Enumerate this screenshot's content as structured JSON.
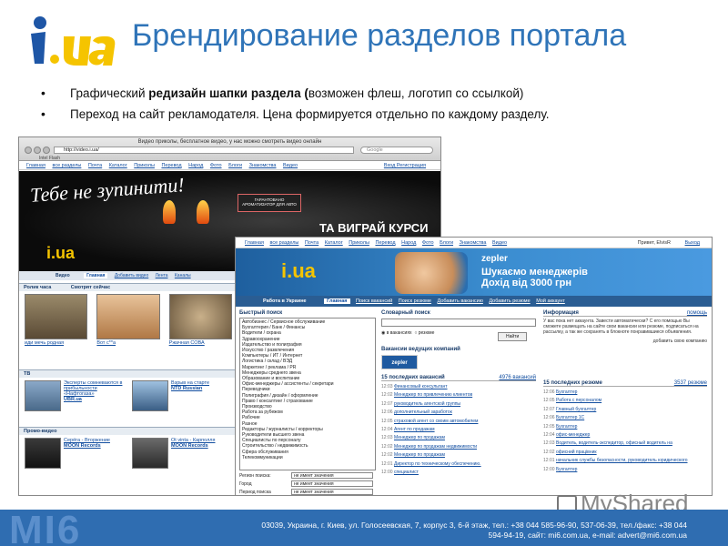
{
  "slide": {
    "title": "Брендирование разделов портала",
    "logo_text": "i.ua",
    "bullets": [
      {
        "pre": "Графический ",
        "bold": "редизайн шапки раздела (",
        "post": "возможен флеш, логотип со ссылкой)"
      },
      {
        "pre": "Переход на сайт рекламодателя. Цена формируется отдельно по каждому разделу.",
        "bold": "",
        "post": ""
      }
    ]
  },
  "screenshot1": {
    "window_title": "Видео приколы, бесплатное видео, у нас можно смотреть видео онлайн",
    "url": "http://video.i.ua/",
    "search_placeholder": "Google",
    "toolbar": "Intel  Flash",
    "site_nav": [
      "Главная",
      "все разделы",
      "Почта",
      "Каталог",
      "Приколы",
      "Перевод",
      "Народ",
      "Фото",
      "Блоги",
      "Знакомства",
      "Видео"
    ],
    "site_nav_right": "Вход   Регистрация",
    "banner": {
      "slogan": "Тебе не зупинити!",
      "badge": "Гарантовано ароматизатор для авто",
      "promo": "ТА ВИГРАЙ КУРСИ"
    },
    "tabs": {
      "section": "Видео",
      "items": [
        "Главная",
        "Добавить видео",
        "Лента",
        "Каналы"
      ]
    },
    "roll_header": "Ролик часа",
    "watch_header": "Смотрят сейчас",
    "thumbs": [
      "иди мечь родная",
      "Вот с**а",
      "Ржачная СОВА"
    ],
    "tv_header": "ТВ",
    "tv_items": [
      {
        "title": "Эксперты сомневаются в прибыльности «Нафтогаза»",
        "src": "UBR.ua"
      },
      {
        "title": "Взрыв на старте",
        "src": "NTD Russian"
      }
    ],
    "promo_header": "Промо-видео",
    "promo_items": [
      {
        "title": "Серёга - Вторжение",
        "src": "MOON Records"
      },
      {
        "title": "Ot vinta - Карполля",
        "src": "MOON Records"
      }
    ]
  },
  "screenshot2": {
    "nav": [
      "Главная",
      "все разделы",
      "Почта",
      "Каталог",
      "Приколы",
      "Перевод",
      "Народ",
      "Фото",
      "Блоги",
      "Знакомства",
      "Видео"
    ],
    "user": "Привет, ElvisR",
    "exit": "Выход",
    "banner": {
      "brand": "zepler",
      "line1": "Шукаємо менеджерів",
      "line2": "Дохід від 3000 грн"
    },
    "tabs": {
      "section": "Работа в Украине",
      "items": [
        "Главная",
        "Поиск вакансий",
        "Поиск резюме",
        "Добавить вакансию",
        "Добавить резюме",
        "Мой аккаунт"
      ]
    },
    "quick_search": "Быстрый поиск",
    "categories": [
      "Автобизнес / Сервисное обслуживание",
      "Бухгалтерия / Банк / Финансы",
      "Водители / охрана",
      "Здравоохранение",
      "Издательство и полиграфия",
      "Искусство / развлечения",
      "Компьютеры / ИТ / Интернет",
      "Логистика / склад / ВЭД",
      "Маркетинг / реклама / PR",
      "Менеджеры среднего звена",
      "Образование и воспитание",
      "Офис-менеджеры / ассистенты / секретари",
      "Переводчики",
      "Полиграфия / дизайн / оформление",
      "Право / консалтинг / страхование",
      "Производство",
      "Работа за рубежом",
      "Рабочие",
      "Разное",
      "Редакторы / журналисты / корректоры",
      "Руководители высшего звена",
      "Специалисты по персоналу",
      "Строительство / недвижимость",
      "Сфера обслуживания",
      "Телекоммуникации"
    ],
    "fields": [
      {
        "label": "Регион поиска:",
        "value": "не имеет значения"
      },
      {
        "label": "Город",
        "value": "не имеет значения"
      },
      {
        "label": "Период поиска",
        "value": "не имеет значения"
      }
    ],
    "dict_search": "Словарный поиск",
    "radio1": "в вакансиях",
    "radio2": "резюме",
    "find": "Найти",
    "leading": "Вакансии ведущих компаний",
    "zepler": "zepler",
    "vac_header": "15 последних вакансий",
    "vac_count": "4976 вакансий",
    "vacancies": [
      {
        "t": "12:03",
        "a": "Финансовый консультант"
      },
      {
        "t": "12:02",
        "a": "Менеджер по привлечению клиентов"
      },
      {
        "t": "12:07",
        "a": "руководитель агентской группы"
      },
      {
        "t": "12:06",
        "a": "дополнительный заработок"
      },
      {
        "t": "12:05",
        "a": "страховой агент со своим автомобилем"
      },
      {
        "t": "12:04",
        "a": "Агент по продажам"
      },
      {
        "t": "12:03",
        "a": "Менеджер по продажам"
      },
      {
        "t": "12:02",
        "a": "Менеджер по продажам недвижимости"
      },
      {
        "t": "12:02",
        "a": "Менеджер по продажам"
      },
      {
        "t": "12:01",
        "a": "Директор по техническому обеспечению."
      },
      {
        "t": "12:00",
        "a": "специалист"
      }
    ],
    "info_header": "Информация",
    "help": "помощь",
    "info_text": "У вас пока нет аккаунта. Завести автоматически? С его помощью Вы сможете размещать на сайте свои вакансии или резюме, подписаться на рассылку, а так же сохранять в блокноте понравившиеся объявления.",
    "add_company": "добавить свою компанию",
    "res_header": "15 последних резюме",
    "res_count": "3537 резюме",
    "resumes": [
      {
        "t": "12:06",
        "a": "Бухгалтер"
      },
      {
        "t": "12:05",
        "a": "Работа с персоналом"
      },
      {
        "t": "12:07",
        "a": "Главный бухгалтер"
      },
      {
        "t": "12:06",
        "a": "Бухгалтер 1С"
      },
      {
        "t": "12:05",
        "a": "Бухгалтер"
      },
      {
        "t": "12:04",
        "a": "офис-менеджер"
      },
      {
        "t": "12:03",
        "a": "Водитель, водитель-экспедитор, офисный водитель на"
      },
      {
        "t": "12:02",
        "a": "офисний працівник"
      },
      {
        "t": "12:01",
        "a": "начальник службы безопасности, руководитель юридического"
      },
      {
        "t": "12:00",
        "a": "Бухгалтер"
      }
    ]
  },
  "footer": {
    "brand": "MI6",
    "line1": "03039, Украина, г. Киев, ул. Голосеевская, 7, корпус 3, 6-й этаж, тел.: +38 044 585-96-90, 537-06-39, тел./факс: +38 044",
    "line2": "594-94-19, сайт: mi6.com.ua, e-mail: advert@mi6.com.ua"
  },
  "watermark": "MyShared",
  "colors": {
    "title": "#2f74b8",
    "footer": "#2f6db1",
    "logo_yellow": "#f5c400",
    "logo_blue": "#1e56a6"
  }
}
